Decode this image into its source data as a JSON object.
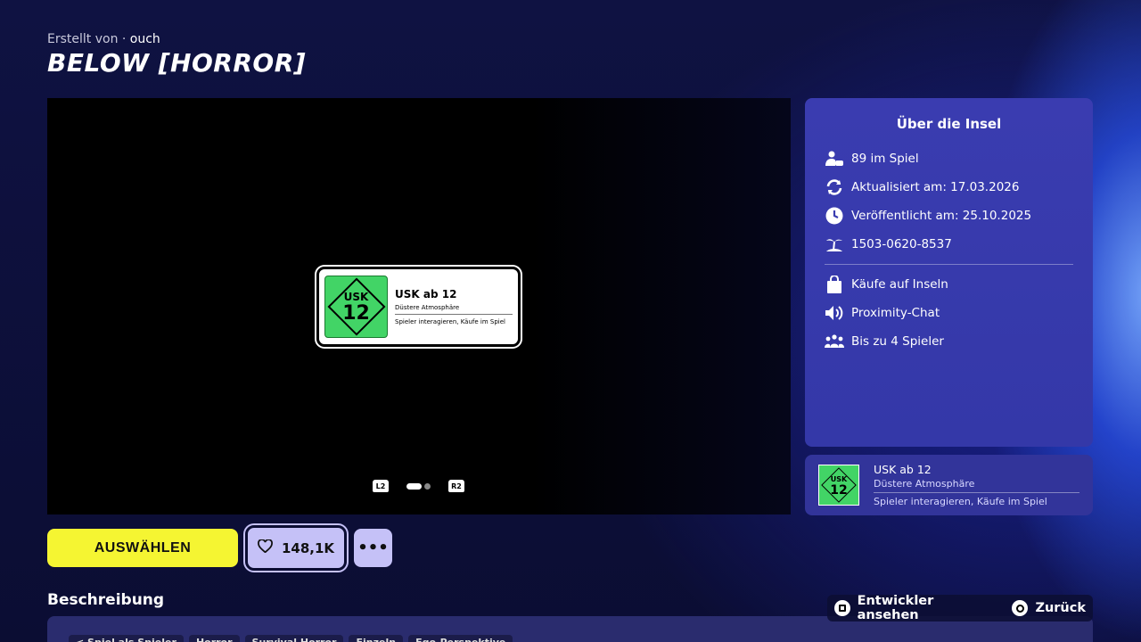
{
  "header": {
    "creator_prefix": "Erstellt von ·",
    "creator_name": "ouch",
    "title": "BELOW [HORROR]"
  },
  "media": {
    "rating_card": {
      "usk_label": "USK",
      "usk_number": "12",
      "rating": "USK ab 12",
      "descriptor": "Düstere Atmosphäre",
      "features": "Spieler interagieren,  Käufe im Spiel"
    },
    "pager": {
      "left_trigger": "L2",
      "right_trigger": "R2",
      "total_pages": 2,
      "current_page": 1
    }
  },
  "actions": {
    "select_label": "AUSWÄHLEN",
    "like_count": "148,1K",
    "more_label": "•••"
  },
  "description": {
    "heading": "Beschreibung",
    "tags": [
      "< Spiel als Spieler",
      "Horror",
      "Survival Horror",
      "Einzeln",
      "Ego-Perspektive"
    ]
  },
  "info_panel": {
    "title": "Über die Insel",
    "stats": [
      {
        "icon": "players-icon",
        "text": "89 im Spiel"
      },
      {
        "icon": "refresh-icon",
        "text": "Aktualisiert am: 17.03.2026"
      },
      {
        "icon": "clock-icon",
        "text": "Veröffentlicht am: 25.10.2025"
      },
      {
        "icon": "island-icon",
        "text": "1503-0620-8537"
      }
    ],
    "features": [
      {
        "icon": "shopping-bag-icon",
        "text": "Käufe auf Inseln"
      },
      {
        "icon": "speaker-icon",
        "text": "Proximity-Chat"
      },
      {
        "icon": "group-icon",
        "text": "Bis zu 4 Spieler"
      }
    ]
  },
  "rating_panel": {
    "usk_label": "USK",
    "usk_number": "12",
    "rating": "USK ab 12",
    "descriptor": "Düstere Atmosphäre",
    "features": "Spieler interagieren,  Käufe im Spiel"
  },
  "hints": {
    "developer": "Entwickler ansehen",
    "back": "Zurück"
  },
  "colors": {
    "select_button": "#f5f532",
    "like_button": "#c5c1f7",
    "panel": "#3a3cb0",
    "usk_green": "#42d466"
  }
}
